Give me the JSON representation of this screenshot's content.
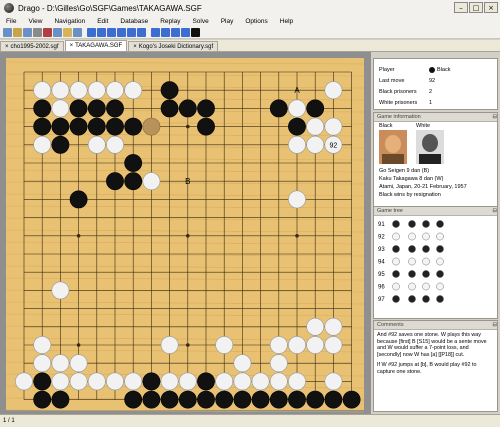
{
  "window": {
    "title": "Drago - D:\\Gilles\\Go\\SGF\\Games\\TAKAGAWA.SGF"
  },
  "menu": [
    "File",
    "View",
    "Navigation",
    "Edit",
    "Database",
    "Replay",
    "Solve",
    "Play",
    "Options",
    "Help"
  ],
  "tabs": [
    {
      "label": "cho1995-2002.sgf",
      "active": false
    },
    {
      "label": "TAKAGAWA.SGF",
      "active": true
    },
    {
      "label": "Kogo's Joseki Dictionary.sgf",
      "active": false
    }
  ],
  "board": {
    "size": 19,
    "black": [
      [
        8,
        1
      ],
      [
        1,
        2
      ],
      [
        3,
        2
      ],
      [
        4,
        2
      ],
      [
        5,
        2
      ],
      [
        8,
        2
      ],
      [
        9,
        2
      ],
      [
        10,
        2
      ],
      [
        14,
        2
      ],
      [
        16,
        2
      ],
      [
        1,
        3
      ],
      [
        2,
        3
      ],
      [
        3,
        3
      ],
      [
        4,
        3
      ],
      [
        5,
        3
      ],
      [
        6,
        3
      ],
      [
        10,
        3
      ],
      [
        15,
        3
      ],
      [
        2,
        4
      ],
      [
        6,
        5
      ],
      [
        5,
        6
      ],
      [
        6,
        6
      ],
      [
        3,
        7
      ],
      [
        1,
        17
      ],
      [
        7,
        17
      ],
      [
        10,
        17
      ],
      [
        1,
        18
      ],
      [
        2,
        18
      ],
      [
        6,
        18
      ],
      [
        7,
        18
      ],
      [
        8,
        18
      ],
      [
        9,
        18
      ],
      [
        10,
        18
      ],
      [
        11,
        18
      ],
      [
        12,
        18
      ],
      [
        13,
        18
      ],
      [
        14,
        18
      ],
      [
        15,
        18
      ],
      [
        16,
        18
      ],
      [
        17,
        18
      ],
      [
        18,
        18
      ]
    ],
    "white": [
      [
        1,
        1
      ],
      [
        2,
        1
      ],
      [
        3,
        1
      ],
      [
        4,
        1
      ],
      [
        5,
        1
      ],
      [
        6,
        1
      ],
      [
        17,
        1
      ],
      [
        4,
        2
      ],
      [
        15,
        2
      ],
      [
        2,
        2
      ],
      [
        16,
        3
      ],
      [
        17,
        3
      ],
      [
        1,
        4
      ],
      [
        4,
        4
      ],
      [
        5,
        4
      ],
      [
        15,
        4
      ],
      [
        16,
        4
      ],
      [
        7,
        6
      ],
      [
        2,
        12
      ],
      [
        15,
        7
      ],
      [
        16,
        14
      ],
      [
        17,
        14
      ],
      [
        1,
        15
      ],
      [
        8,
        15
      ],
      [
        11,
        15
      ],
      [
        14,
        15
      ],
      [
        15,
        15
      ],
      [
        16,
        15
      ],
      [
        17,
        15
      ],
      [
        1,
        16
      ],
      [
        2,
        16
      ],
      [
        3,
        16
      ],
      [
        12,
        16
      ],
      [
        14,
        16
      ],
      [
        0,
        17
      ],
      [
        2,
        17
      ],
      [
        3,
        17
      ],
      [
        4,
        17
      ],
      [
        5,
        17
      ],
      [
        6,
        17
      ],
      [
        8,
        17
      ],
      [
        9,
        17
      ],
      [
        11,
        17
      ],
      [
        12,
        17
      ],
      [
        13,
        17
      ],
      [
        14,
        17
      ],
      [
        15,
        17
      ],
      [
        17,
        17
      ]
    ],
    "last": [
      17,
      4
    ],
    "last_label": "92",
    "dim": [
      [
        7,
        3
      ]
    ],
    "labels": [
      {
        "text": "A",
        "pt": [
          15,
          1
        ]
      },
      {
        "text": "B",
        "pt": [
          9,
          6
        ]
      }
    ]
  },
  "info": {
    "header": "Player",
    "player_label": "Player",
    "player_value": "Black",
    "last_move_label": "Last move",
    "last_move_value": "92",
    "black_prisoners_label": "Black prisoners",
    "black_prisoners_value": "2",
    "white_prisoners_label": "White prisoners",
    "white_prisoners_value": "1"
  },
  "game": {
    "header": "Game information",
    "black_label": "Black",
    "white_label": "White",
    "line1": "Go Seigen 9 dan (B)",
    "line2": "Kaku Takagawa 8 dan (W)",
    "line3": "Atami, Japan, 20-21 February, 1957",
    "line4": "Black wins by resignation"
  },
  "tree": {
    "header": "Game tree",
    "moves": [
      "91",
      "92",
      "93",
      "94",
      "95",
      "96",
      "97"
    ]
  },
  "comments": {
    "header": "Comments",
    "p1": "And #92 saves one stone. W plays this way because [first] B [S15] would be a sente move and W would suffer a 7-point loss, and [secondly] now W has [a] [[P18]] cut.",
    "p2": "If W #92 jumps at [b], B would play #92 to capture one stone."
  },
  "status": {
    "position": "1 / 1"
  }
}
